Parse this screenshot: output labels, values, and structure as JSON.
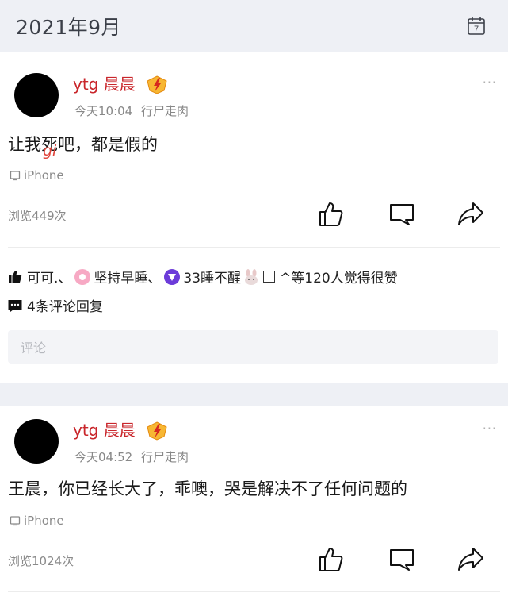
{
  "header": {
    "month": "2021年9月",
    "calendar_day": "7"
  },
  "posts": [
    {
      "username": "ytg 晨晨",
      "time": "今天10:04",
      "source": "行尸走肉",
      "more": "···",
      "content_a": "让我",
      "content_b": "死",
      "content_c": "吧，都是假的",
      "overlay": "gi",
      "device": "iPhone",
      "views": "浏览449次",
      "likes_prefix": "可可.、",
      "likes_mid1": "坚持早睡、",
      "likes_mid2": "33睡不醒",
      "likes_suffix": "^等120人觉得很赞",
      "comments_count": "4条评论回复",
      "comment_placeholder": "评论"
    },
    {
      "username": "ytg 晨晨",
      "time": "今天04:52",
      "source": "行尸走肉",
      "more": "···",
      "content": "王晨，你已经长大了，乖噢，哭是解决不了任何问题的",
      "device": "iPhone",
      "views": "浏览1024次"
    }
  ],
  "colors": {
    "username": "#c9262b",
    "badge": "#f4a21b",
    "background": "#eef0f5"
  }
}
